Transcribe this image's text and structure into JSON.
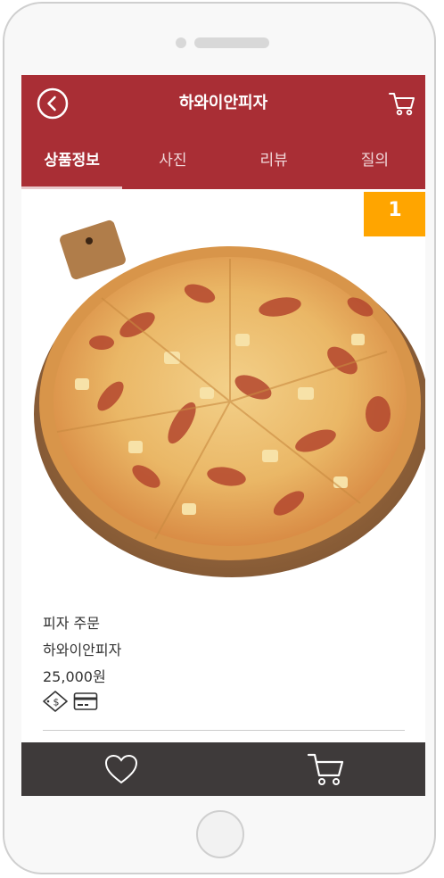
{
  "header": {
    "title": "하와이안피자",
    "back_icon": "chevron-left-circle-icon",
    "cart_icon": "shopping-cart-icon"
  },
  "tabs": [
    {
      "label": "상품정보",
      "active": true
    },
    {
      "label": "사진",
      "active": false
    },
    {
      "label": "리뷰",
      "active": false
    },
    {
      "label": "질의",
      "active": false
    }
  ],
  "badge": {
    "value": "1"
  },
  "product": {
    "category": "피자 주문",
    "name": "하와이안피자",
    "price": "25,000원",
    "payment_icons": [
      "cash-coupon-icon",
      "credit-card-icon"
    ]
  },
  "bottom_bar": {
    "like_icon": "heart-icon",
    "cart_icon": "shopping-cart-icon"
  },
  "colors": {
    "header": "#a92e35",
    "badge": "#ffa500",
    "bottom_bar": "#3e3a3a"
  }
}
